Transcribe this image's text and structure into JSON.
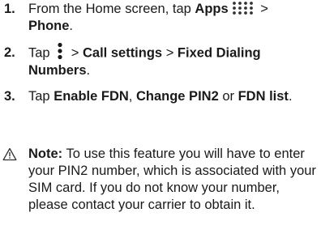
{
  "steps": [
    {
      "number": "1.",
      "text_pre": "From the Home screen, tap ",
      "bold_1": "Apps",
      "after_icon": " > ",
      "bold_2": "Phone",
      "end": ".",
      "icon": "apps-grid-icon"
    },
    {
      "number": "2.",
      "text_pre": "Tap ",
      "sep_1": " > ",
      "bold_1": "Call settings",
      "sep_2": " > ",
      "bold_2": "Fixed Dialing Numbers",
      "end": ".",
      "icon": "menu-dots-icon"
    },
    {
      "number": "3.",
      "text_pre": "Tap ",
      "bold_1": "Enable FDN",
      "sep_1": ", ",
      "bold_2": "Change PIN2",
      "sep_2": " or ",
      "bold_3": "FDN list",
      "end": "."
    }
  ],
  "note": {
    "label": "Note:",
    "text": " To use this feature you will have to enter your PIN2 number, which is associated with your SIM card. If you do not know your number, please contact your carrier to obtain it.",
    "icon": "warning-triangle-icon"
  }
}
